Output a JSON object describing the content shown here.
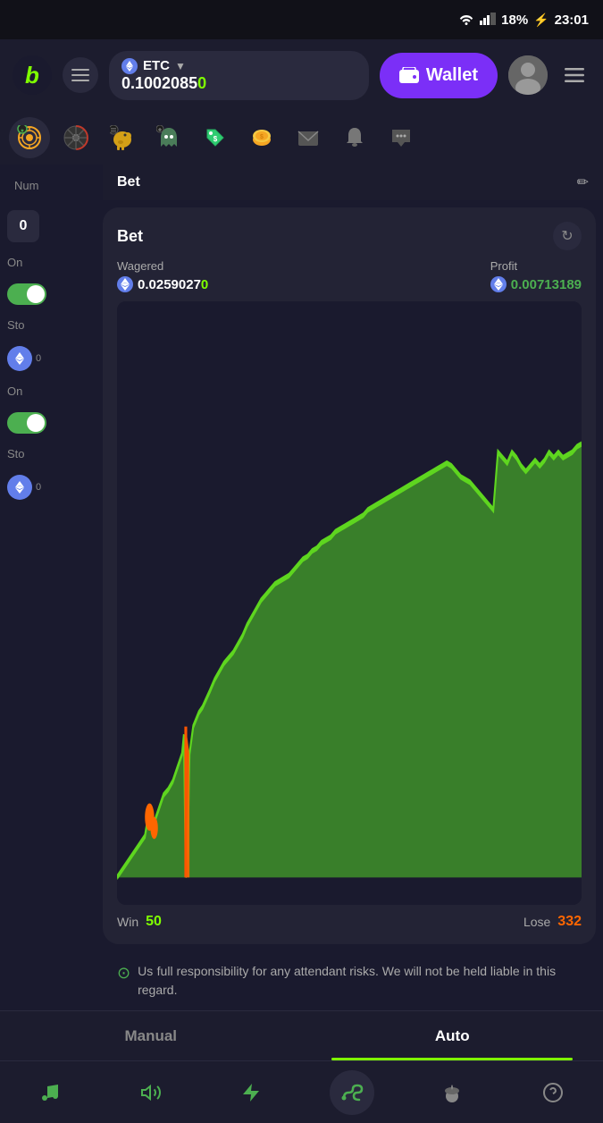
{
  "statusBar": {
    "wifi": "📶",
    "signal": "📶",
    "battery": "18%",
    "time": "23:01"
  },
  "header": {
    "logo": "b",
    "currency": "ETC",
    "balance": "0.10020850",
    "balanceHighlight": "0",
    "walletLabel": "Wallet",
    "menuIcon": "☰"
  },
  "navIcons": [
    {
      "id": "target",
      "emoji": "🎯",
      "active": true
    },
    {
      "id": "wheel",
      "emoji": "🎰",
      "active": false
    },
    {
      "id": "piggy",
      "emoji": "🐷",
      "active": false
    },
    {
      "id": "ghost",
      "emoji": "👾",
      "active": false
    },
    {
      "id": "tag",
      "emoji": "🏷️",
      "active": false
    },
    {
      "id": "coin",
      "emoji": "🪙",
      "active": false
    },
    {
      "id": "mail",
      "emoji": "✉️",
      "active": false
    },
    {
      "id": "bell",
      "emoji": "🔔",
      "active": false
    },
    {
      "id": "chat",
      "emoji": "💬",
      "active": false
    }
  ],
  "leftPanel": {
    "numLabel": "Num",
    "zeroValue": "0",
    "onLabel": "On",
    "stopLabel1": "Sto",
    "onLabel2": "On",
    "stopLabel2": "Sto"
  },
  "betCard": {
    "title": "Bet",
    "refreshIcon": "↻",
    "wageredLabel": "Wagered",
    "wageredValue": "0.02590270",
    "profitLabel": "Profit",
    "profitValue": "0.00713189",
    "winLabel": "Win",
    "winValue": "50",
    "loseLabel": "Lose",
    "loseValue": "332"
  },
  "betHeaderBar": {
    "label": "Bet",
    "editIcon": "✏"
  },
  "disclaimer": {
    "text": "full responsibility for any attendant risks. We will not be held liable in this regard.",
    "partialText": "Us"
  },
  "tabs": [
    {
      "id": "manual",
      "label": "Manual",
      "active": false
    },
    {
      "id": "auto",
      "label": "Auto",
      "active": true
    }
  ],
  "bottomNav": [
    {
      "id": "music",
      "icon": "♪",
      "active": false,
      "color": "green"
    },
    {
      "id": "volume",
      "icon": "🔊",
      "active": false,
      "color": "green"
    },
    {
      "id": "lightning",
      "icon": "⚡",
      "active": false,
      "color": "green"
    },
    {
      "id": "snake",
      "icon": "∿",
      "active": true,
      "color": "green"
    },
    {
      "id": "acorn",
      "icon": "🌰",
      "active": false,
      "color": "gray"
    },
    {
      "id": "help",
      "icon": "?",
      "active": false,
      "color": "gray"
    }
  ],
  "chart": {
    "winColor": "#4caf50",
    "loseColor": "#ff6600",
    "bgColor": "#1a1a2e"
  }
}
